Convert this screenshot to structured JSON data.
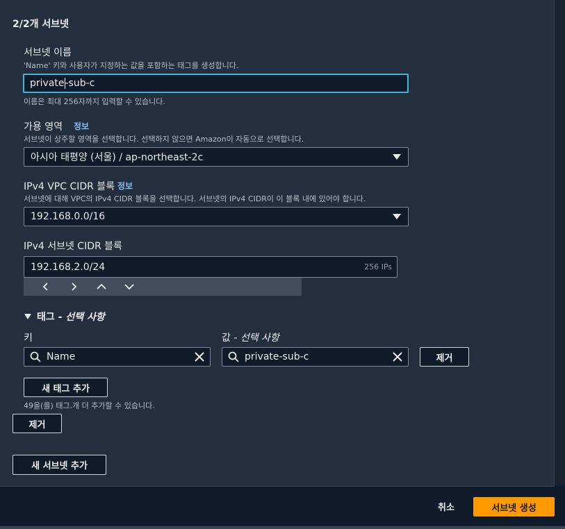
{
  "section": {
    "title": "2/2개 서브넷"
  },
  "subnet_name": {
    "label": "서브넷 이름",
    "description": "'Name' 키와 사용자가 지정하는 값을 포함하는 태그를 생성합니다.",
    "value_before_cursor": "private",
    "value_after_cursor": "-sub-c",
    "hint": "이름은 최대 256자까지 입력할 수 있습니다."
  },
  "availability_zone": {
    "label": "가용 영역",
    "info": "정보",
    "description": "서브넷이 상주할 영역을 선택합니다. 선택하지 않으면 Amazon이 자동으로 선택합니다.",
    "value": "아시아 태평양 (서울) / ap-northeast-2c"
  },
  "vpc_cidr": {
    "label": "IPv4 VPC CIDR 블록",
    "info": "정보",
    "description": "서브넷에 대해 VPC의 IPv4 CIDR 블록을 선택합니다. 서브넷의 IPv4 CIDR이 이 블록 내에 있어야 합니다.",
    "value": "192.168.0.0/16"
  },
  "subnet_cidr": {
    "label": "IPv4 서브넷 CIDR 블록",
    "value": "192.168.2.0/24",
    "suffix": "256 IPs",
    "nav_icons": [
      "chevron-left-icon",
      "chevron-right-icon",
      "chevron-up-icon",
      "chevron-down-icon"
    ]
  },
  "tags": {
    "toggle_prefix": "태그 - ",
    "toggle_optional": "선택 사항",
    "key_label": "키",
    "value_label_prefix": "값 - ",
    "value_label_optional": "선택 사항",
    "key_value": "Name",
    "value_value": "private-sub-c",
    "remove_label": "제거",
    "add_tag_label": "새 태그 추가",
    "limit_text": "49을(를) 태그.개 더 추가할 수 있습니다."
  },
  "remove_subnet_label": "제거",
  "add_subnet_label": "새 서브넷 추가",
  "footer": {
    "cancel_label": "취소",
    "create_label": "서브넷 생성"
  },
  "colors": {
    "background": "#0f1b2a",
    "panel": "#232f3e",
    "accent_orange": "#ff9900",
    "focus_blue": "#44b9d6",
    "info_link": "#89bdee"
  }
}
